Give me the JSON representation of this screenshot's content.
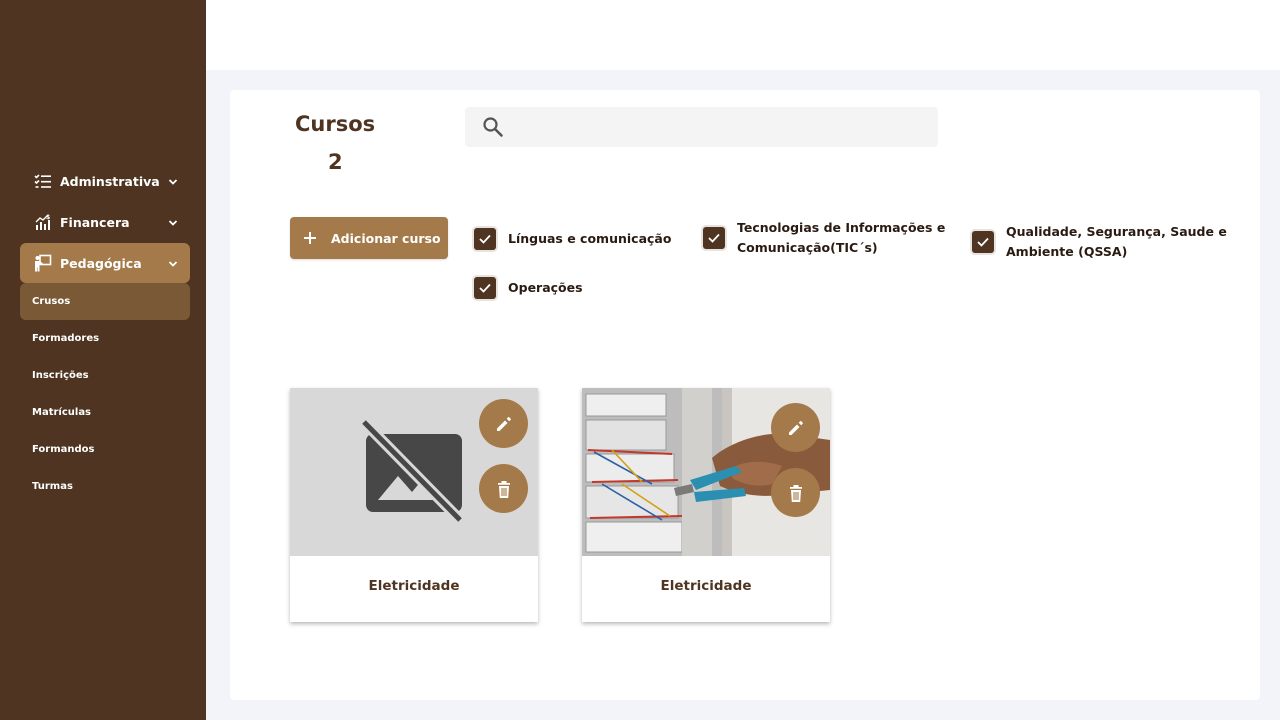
{
  "sidebar": {
    "groups": [
      {
        "label": "Adminstrativa"
      },
      {
        "label": "Financera"
      },
      {
        "label": "Pedagógica"
      }
    ],
    "subitems": [
      {
        "label": "Crusos"
      },
      {
        "label": "Formadores"
      },
      {
        "label": "Inscrições"
      },
      {
        "label": "Matrículas"
      },
      {
        "label": "Formandos"
      },
      {
        "label": "Turmas"
      }
    ],
    "active_group": "Pedagógica",
    "active_subitem": "Crusos"
  },
  "header": {
    "title": "Cursos",
    "count": "2"
  },
  "search": {
    "value": "",
    "icon": "search-icon"
  },
  "toolbar": {
    "add_label": "Adicionar curso"
  },
  "filters": [
    {
      "label": "Línguas e comunicação",
      "checked": true
    },
    {
      "line1": "Tecnologias de Informações e",
      "line2": "Comunicação(TIC´s)",
      "checked": true
    },
    {
      "line1": "Qualidade, Segurança, Saude e",
      "line2": "Ambiente (QSSA)",
      "checked": true
    },
    {
      "label": "Operações",
      "checked": true
    }
  ],
  "courses": [
    {
      "title": "Eletricidade",
      "image": "no-image-placeholder"
    },
    {
      "title": "Eletricidade",
      "image": "electrician-panel-photo"
    }
  ],
  "colors": {
    "sidebar": "#4e3421",
    "accent": "#a47a4a",
    "active_subitem": "#7a5937",
    "background": "#f3f4f9"
  }
}
